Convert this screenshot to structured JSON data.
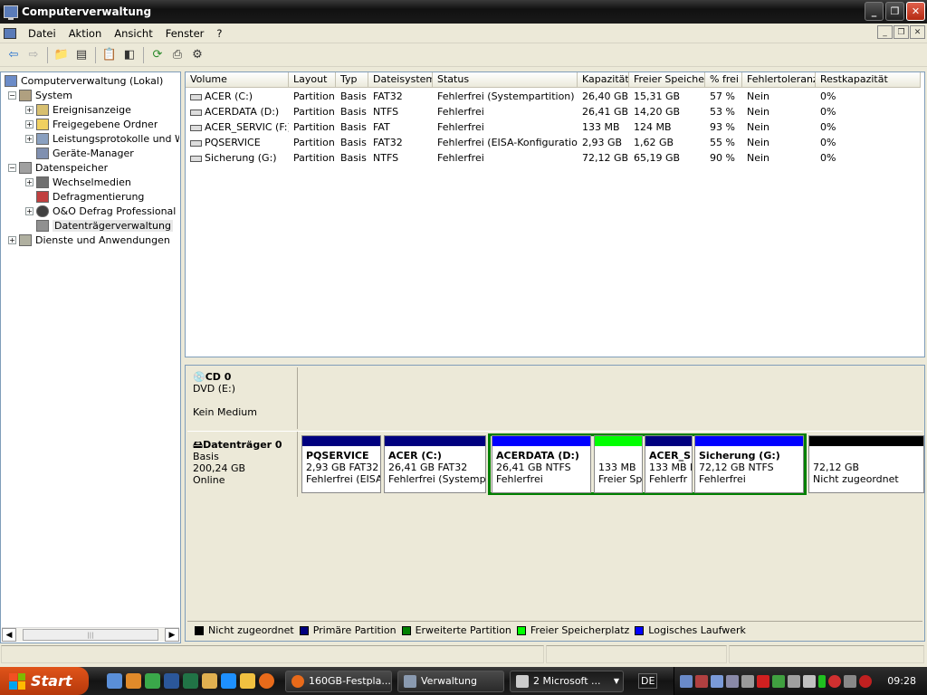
{
  "window": {
    "title": "Computerverwaltung"
  },
  "menu": [
    "Datei",
    "Aktion",
    "Ansicht",
    "Fenster",
    "?"
  ],
  "tree": {
    "root": "Computerverwaltung (Lokal)",
    "system": "System",
    "ereignis": "Ereignisanzeige",
    "freigegeben": "Freigegebene Ordner",
    "leistung": "Leistungsprotokolle und Wa",
    "geraete": "Geräte-Manager",
    "datenspeicher": "Datenspeicher",
    "wechsel": "Wechselmedien",
    "defrag": "Defragmentierung",
    "oo": "O&O Defrag Professional Ed",
    "dtv": "Datenträgerverwaltung",
    "dienste": "Dienste und Anwendungen"
  },
  "columns": [
    "Volume",
    "Layout",
    "Typ",
    "Dateisystem",
    "Status",
    "Kapazität",
    "Freier Speicher",
    "% frei",
    "Fehlertoleranz",
    "Restkapazität"
  ],
  "volumes": [
    [
      "ACER (C:)",
      "Partition",
      "Basis",
      "FAT32",
      "Fehlerfrei (Systempartition)",
      "26,40 GB",
      "15,31 GB",
      "57 %",
      "Nein",
      "0%"
    ],
    [
      "ACERDATA (D:)",
      "Partition",
      "Basis",
      "NTFS",
      "Fehlerfrei",
      "26,41 GB",
      "14,20 GB",
      "53 %",
      "Nein",
      "0%"
    ],
    [
      "ACER_SERVIC (F:)",
      "Partition",
      "Basis",
      "FAT",
      "Fehlerfrei",
      "133 MB",
      "124 MB",
      "93 %",
      "Nein",
      "0%"
    ],
    [
      "PQSERVICE",
      "Partition",
      "Basis",
      "FAT32",
      "Fehlerfrei (EISA-Konfiguration)",
      "2,93 GB",
      "1,62 GB",
      "55 %",
      "Nein",
      "0%"
    ],
    [
      "Sicherung (G:)",
      "Partition",
      "Basis",
      "NTFS",
      "Fehlerfrei",
      "72,12 GB",
      "65,19 GB",
      "90 %",
      "Nein",
      "0%"
    ]
  ],
  "cd": {
    "name": "CD 0",
    "type": "DVD (E:)",
    "status": "Kein Medium"
  },
  "disk": {
    "name": "Datenträger 0",
    "type": "Basis",
    "size": "200,24 GB",
    "status": "Online"
  },
  "partitions": [
    {
      "title": "PQSERVICE",
      "line2": "2,93 GB FAT32",
      "line3": "Fehlerfrei (EISA",
      "color": "#00007f"
    },
    {
      "title": "ACER  (C:)",
      "line2": "26,41 GB FAT32",
      "line3": "Fehlerfrei (Systempa",
      "color": "#00007f"
    },
    {
      "title": "ACERDATA  (D:)",
      "line2": "26,41 GB NTFS",
      "line3": "Fehlerfrei",
      "color": "#0000ff"
    },
    {
      "title": "",
      "line2": "133 MB",
      "line3": "Freier Sp",
      "color": "#00ff00"
    },
    {
      "title": "ACER_S",
      "line2": "133 MB I",
      "line3": "Fehlerfr",
      "color": "#00007f"
    },
    {
      "title": "Sicherung  (G:)",
      "line2": "72,12 GB NTFS",
      "line3": "Fehlerfrei",
      "color": "#0000ff"
    },
    {
      "title": "",
      "line2": "72,12 GB",
      "line3": "Nicht zugeordnet",
      "color": "#000000"
    }
  ],
  "legend": [
    {
      "label": "Nicht zugeordnet",
      "color": "#000000"
    },
    {
      "label": "Primäre Partition",
      "color": "#00007f"
    },
    {
      "label": "Erweiterte Partition",
      "color": "#008000"
    },
    {
      "label": "Freier Speicherplatz",
      "color": "#00ff00"
    },
    {
      "label": "Logisches Laufwerk",
      "color": "#0000ff"
    }
  ],
  "taskbar": {
    "start": "Start",
    "tasks": [
      "160GB-Festpla...",
      "Verwaltung",
      "2 Microsoft ..."
    ],
    "lang": "DE",
    "clock": "09:28"
  }
}
